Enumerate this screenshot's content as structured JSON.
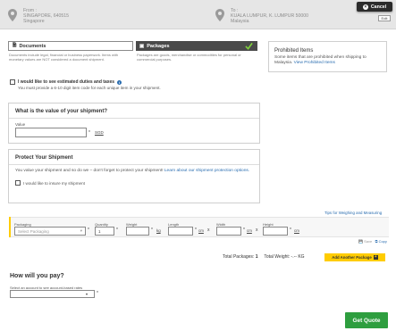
{
  "header": {
    "from": {
      "label": "From :",
      "city": "SINGAPORE, 640515",
      "country": "Singapore"
    },
    "to": {
      "label": "To :",
      "city": "KUALA LUMPUR, K. LUMPUR 50000",
      "country": "Malaysia"
    },
    "cancel_label": "Cancel",
    "edit_label": "Edit"
  },
  "shipment_types": {
    "documents": {
      "label": "Documents",
      "description": "Documents include legal, financial or business paperwork. Items with monetary values are NOT considered a document shipment."
    },
    "packages": {
      "label": "Packages",
      "description": "Packages are goods, merchandise or commodities for personal or commercial purposes.",
      "selected": true
    }
  },
  "prohibited": {
    "title": "Prohibited Items",
    "text": "Some items that are prohibited when shipping to Malaysia.",
    "link": "View Prohibited Items"
  },
  "duties": {
    "label": "I would like to see estimated duties and taxes",
    "info_icon": "i",
    "note": "You must provide a 6-10 digit item code for each unique item in your shipment."
  },
  "value_section": {
    "title": "What is the value of your shipment?",
    "field_label": "Value",
    "required_mark": "*",
    "currency": "SGD"
  },
  "protect_section": {
    "title": "Protect Your Shipment",
    "text": "You value your shipment and so do we – don't forget to protect your shipment!",
    "link": "Learn about our shipment protection options.",
    "insure_label": "I would like to insure my shipment"
  },
  "package_row": {
    "tips_link": "Tips for Weighing and Measuring",
    "packaging_label": "Packaging",
    "packaging_placeholder": "Select Packaging",
    "quantity_label": "Quantity",
    "quantity_value": "1",
    "weight_label": "Weight",
    "weight_unit": "kg",
    "length_label": "Length",
    "width_label": "Width",
    "height_label": "Height",
    "dim_unit": "cm",
    "required_mark": "*",
    "times": "x",
    "save_label": "Save",
    "copy_label": "Copy"
  },
  "totals": {
    "packages_label": "Total Packages:",
    "packages_value": "1",
    "weight_label": "Total Weight:",
    "weight_value": "-.-- KG",
    "add_package_label": "Add Another Package"
  },
  "payment": {
    "title": "How will you pay?",
    "select_label": "Select an account to see account-based rates",
    "required_mark": "*"
  },
  "get_quote_label": "Get Quote",
  "colors": {
    "accent_yellow": "#ffcc00",
    "quote_green": "#2e9e3f",
    "link_blue": "#2a6db0",
    "selected_tile": "#4a4a4a"
  }
}
